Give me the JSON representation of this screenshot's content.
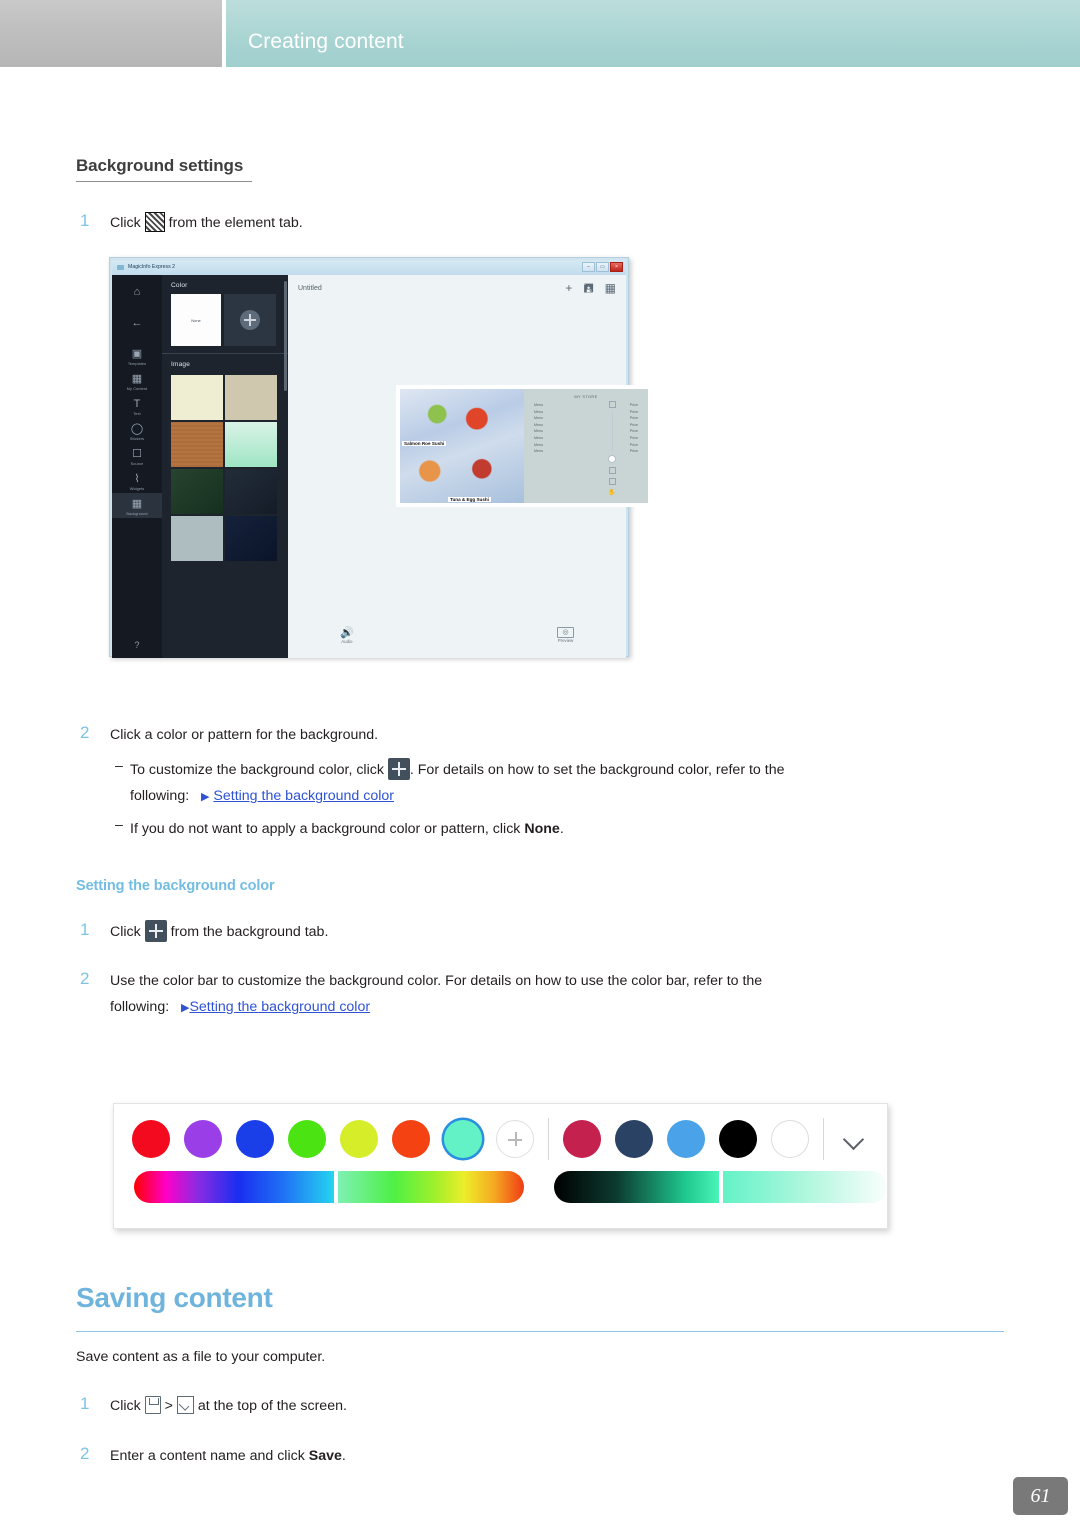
{
  "header": {
    "title": "Creating content",
    "left_block_color": "#bdbdbd",
    "right_block_color": "#a8d4d2"
  },
  "sections": {
    "background_settings": {
      "heading": "Background settings",
      "step1_num": "1",
      "step1_before": "Click",
      "step1_after": "from the element tab.",
      "step2_num": "2",
      "step2_text": "Click a color or pattern for the background.",
      "bullet1_dash": "–",
      "bullet1_before": "To customize the background color, click",
      "bullet1_after": ". For details on how to set the background color, refer to the",
      "bullet1_following": "following:",
      "bullet1_link": "Setting the background color",
      "bullet2_dash": "–",
      "bullet2_before": "If you do not want to apply a background color or pattern, click",
      "bullet2_bold": "None",
      "bullet2_end": "."
    },
    "setting_background_color": {
      "heading": "Setting the background color",
      "step1_num": "1",
      "step1_before": "Click",
      "step1_after": "from the background tab.",
      "step2_num": "2",
      "step2_text": "Use the color bar to customize the background color. For details on how to use the color bar, refer to the",
      "step2_following": "following:",
      "step2_link": "Setting the background color"
    },
    "saving_content": {
      "heading": "Saving content",
      "intro": "Save content as a file to your computer.",
      "step1_num": "1",
      "step1_before": "Click",
      "step1_mid": ">",
      "step1_after": "at the top of the screen.",
      "step2_num": "2",
      "step2_before": "Enter a content name and click",
      "step2_bold": "Save",
      "step2_end": "."
    }
  },
  "app_screenshot": {
    "window_title": "MagicInfo Express 2",
    "window_buttons": [
      "–",
      "▭",
      "×"
    ],
    "rail": [
      {
        "name": "home-icon",
        "label": ""
      },
      {
        "name": "back-arrow-icon",
        "label": ""
      },
      {
        "name": "templates-icon",
        "label": "Templates"
      },
      {
        "name": "my-content-icon",
        "label": "My Content"
      },
      {
        "name": "text-icon",
        "label": "Text"
      },
      {
        "name": "stickers-icon",
        "label": "Stickers"
      },
      {
        "name": "source-icon",
        "label": "Source"
      },
      {
        "name": "widgets-icon",
        "label": "Widgets"
      },
      {
        "name": "background-icon",
        "label": "Background"
      }
    ],
    "rail_help": "?",
    "panel": {
      "color_heading": "Color",
      "none_swatch": "None",
      "image_heading": "Image",
      "image_swatches": [
        "#efeed3",
        "#cfc8ae",
        "#b5733f",
        "#b6ead1",
        "#1e3a2c",
        "#1b2430",
        "#aebdc0",
        "#101c33"
      ]
    },
    "canvas": {
      "doc_title": "Untitled",
      "toolbar_icons": [
        "plus-icon",
        "save-icon",
        "layout-grid-icon"
      ],
      "stage": {
        "caption1": "Salmon Roe Sushi",
        "caption2": "Tuna & Egg Sushi",
        "menu_title": "MY STORE",
        "menu_rows": [
          {
            "name": "Menu",
            "price": "Price"
          },
          {
            "name": "Menu",
            "price": "Price"
          },
          {
            "name": "Menu",
            "price": "Price"
          },
          {
            "name": "Menu",
            "price": "Price"
          },
          {
            "name": "Menu",
            "price": "Price"
          },
          {
            "name": "Menu",
            "price": "Price"
          },
          {
            "name": "Menu",
            "price": "Price"
          },
          {
            "name": "Menu",
            "price": "Price"
          }
        ]
      },
      "bottom": {
        "audio_label": "Audio",
        "preview_label": "Preview",
        "preview_glyph": "◎"
      },
      "zoom_tools": {
        "plus": "+",
        "fit": "✥",
        "hand": "✋"
      }
    }
  },
  "color_picker": {
    "swatches_left": [
      {
        "name": "red",
        "color": "#f40a1e",
        "selected": false
      },
      {
        "name": "purple",
        "color": "#9a3fe8",
        "selected": false
      },
      {
        "name": "blue",
        "color": "#1a3fe8",
        "selected": false
      },
      {
        "name": "green",
        "color": "#4ce313",
        "selected": false
      },
      {
        "name": "yellow-green",
        "color": "#d6ee2a",
        "selected": false
      },
      {
        "name": "orange-red",
        "color": "#f44212",
        "selected": false
      },
      {
        "name": "mint",
        "color": "#63f2c6",
        "selected": true
      }
    ],
    "add_swatch": "plus-icon",
    "swatches_right": [
      {
        "name": "crimson",
        "color": "#c4214f",
        "selected": false
      },
      {
        "name": "navy",
        "color": "#2a4264",
        "selected": false
      },
      {
        "name": "sky-blue",
        "color": "#4aa3e8",
        "selected": false
      },
      {
        "name": "black",
        "color": "#000000",
        "selected": false
      },
      {
        "name": "white",
        "color": "#ffffff",
        "selected": false
      }
    ],
    "expand_icon": "chevron-down-icon",
    "hue_bar_left": "linear-gradient(90deg,#ff0000,#ff00c8,#8a2be2,#1a2ef0,#1f6ff5,#25d5ef)",
    "hue_bar_right": "linear-gradient(90deg,#7ff0b4,#4ef045,#9ff02a,#eded2a,#f5a821,#f03c14)",
    "value_bar_left": "linear-gradient(90deg,#000000,#0c3b30,#1fc98f,#4bf5b9)",
    "value_bar_right": "linear-gradient(90deg,#63f2c6,#b6f7e0,#fafefd)"
  },
  "page_number": "61"
}
